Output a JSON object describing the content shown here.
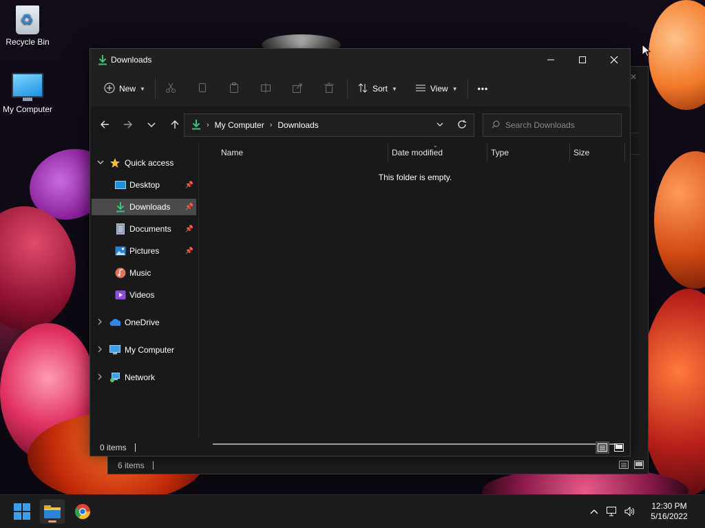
{
  "desktop": {
    "icons": [
      {
        "label": "Recycle Bin",
        "icon": "recycle-bin-icon"
      },
      {
        "label": "My Computer",
        "icon": "computer-icon"
      }
    ]
  },
  "bg_window": {
    "status": {
      "count": "6 items"
    }
  },
  "window": {
    "title": "Downloads",
    "controls": {
      "minimize": "—",
      "maximize": "☐",
      "close": "✕"
    },
    "commandbar": {
      "new_label": "New",
      "sort_label": "Sort",
      "view_label": "View",
      "more_label": "•••"
    },
    "address": {
      "crumbs": [
        "My Computer",
        "Downloads"
      ]
    },
    "search": {
      "placeholder": "Search Downloads"
    },
    "nav": {
      "quick_access": "Quick access",
      "quick_items": [
        {
          "label": "Desktop",
          "icon": "desktop-icon",
          "pinned": true
        },
        {
          "label": "Downloads",
          "icon": "downloads-icon",
          "pinned": true,
          "selected": true
        },
        {
          "label": "Documents",
          "icon": "documents-icon",
          "pinned": true
        },
        {
          "label": "Pictures",
          "icon": "pictures-icon",
          "pinned": true
        },
        {
          "label": "Music",
          "icon": "music-icon",
          "pinned": false
        },
        {
          "label": "Videos",
          "icon": "videos-icon",
          "pinned": false
        }
      ],
      "onedrive": "OneDrive",
      "my_computer": "My Computer",
      "network": "Network"
    },
    "columns": [
      "Name",
      "Date modified",
      "Type",
      "Size"
    ],
    "empty_message": "This folder is empty.",
    "status": {
      "count": "0 items"
    }
  },
  "taskbar": {
    "clock": {
      "time": "12:30 PM",
      "date": "5/16/2022"
    }
  },
  "colors": {
    "accent_green": "#3ec27a",
    "window_bg": "#191919",
    "selected": "#4a4a4a"
  }
}
